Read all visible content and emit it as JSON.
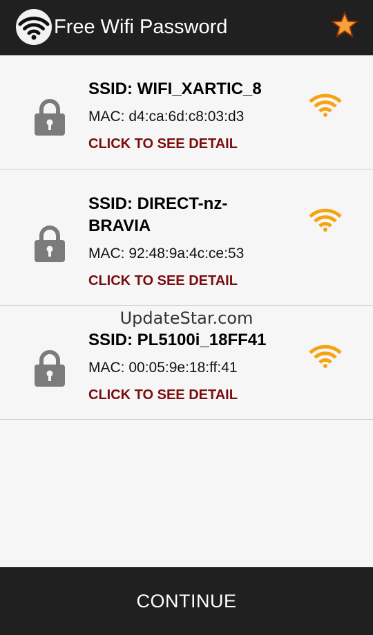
{
  "header": {
    "title": "Free Wifi Password",
    "app_icon": "wifi-icon",
    "favorite_icon": "star-icon"
  },
  "networks": [
    {
      "ssid": "SSID: WIFI_XARTIC_8",
      "mac": "MAC: d4:ca:6d:c8:03:d3",
      "action": "CLICK TO SEE DETAIL",
      "lock_icon": "lock-icon",
      "signal_icon": "wifi-signal-icon"
    },
    {
      "ssid": "SSID: DIRECT-nz-BRAVIA",
      "mac": "MAC: 92:48:9a:4c:ce:53",
      "action": "CLICK TO SEE DETAIL",
      "lock_icon": "lock-icon",
      "signal_icon": "wifi-signal-icon"
    },
    {
      "ssid": "SSID: PL5100i_18FF41",
      "mac": "MAC: 00:05:9e:18:ff:41",
      "action": "CLICK TO SEE DETAIL",
      "lock_icon": "lock-icon",
      "signal_icon": "wifi-signal-icon"
    }
  ],
  "watermark": "UpdateStar.com",
  "footer": {
    "continue_label": "CONTINUE"
  },
  "colors": {
    "header_bg": "#202020",
    "list_bg": "#f6f6f6",
    "link": "#7a0d0d",
    "signal": "#f6a313",
    "lock": "#7b7b7b"
  }
}
